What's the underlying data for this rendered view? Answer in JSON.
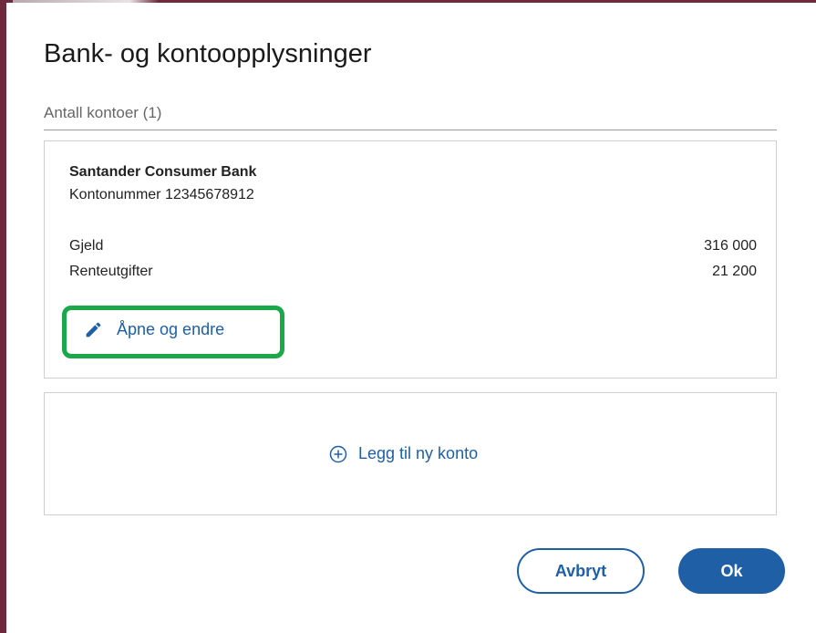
{
  "dialog": {
    "title": "Bank- og kontoopplysninger",
    "account_count_label": "Antall kontoer (1)"
  },
  "account": {
    "bank_name": "Santander Consumer Bank",
    "account_number_label": "Kontonummer 12345678912",
    "rows": [
      {
        "label": "Gjeld",
        "value": "316 000"
      },
      {
        "label": "Renteutgifter",
        "value": "21 200"
      }
    ],
    "edit_link": "Åpne og endre",
    "edit_icon": "pencil-icon",
    "highlight_color": "#1aa84b"
  },
  "add_account": {
    "label": "Legg til ny konto",
    "icon": "plus-circle-icon"
  },
  "buttons": {
    "cancel": "Avbryt",
    "ok": "Ok"
  },
  "colors": {
    "accent": "#1f5fa6",
    "frame": "#6e2a3c"
  }
}
